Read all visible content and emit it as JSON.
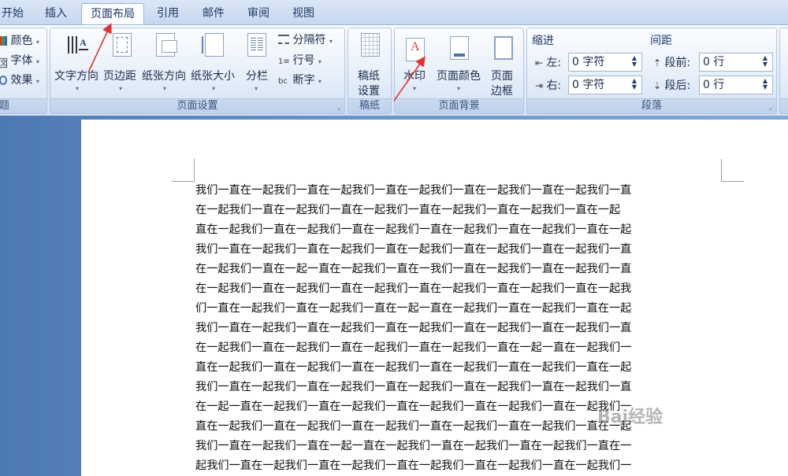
{
  "tabs": [
    "开始",
    "插入",
    "页面布局",
    "引用",
    "邮件",
    "审阅",
    "视图"
  ],
  "theme_group": {
    "label": "题",
    "colors": "颜色",
    "fonts": "字体",
    "effects": "效果"
  },
  "page_setup": {
    "label": "页面设置",
    "text_direction": "文字方向",
    "margins": "页边距",
    "orientation": "纸张方向",
    "size": "纸张大小",
    "columns": "分栏",
    "breaks": "分隔符",
    "line_numbers": "行号",
    "hyphenation": "断字"
  },
  "draft_paper": {
    "label": "稿纸",
    "button_line1": "稿纸",
    "button_line2": "设置"
  },
  "page_background": {
    "label": "页面背景",
    "watermark": "水印",
    "page_color": "页面颜色",
    "border_line1": "页面",
    "border_line2": "边框"
  },
  "paragraph": {
    "label": "段落",
    "indent_title": "缩进",
    "left_label": "左:",
    "left_value": "0 字符",
    "right_label": "右:",
    "right_value": "0 字符",
    "spacing_title": "间距",
    "before_label": "段前:",
    "before_value": "0 行",
    "after_label": "段后:",
    "after_value": "0 行"
  },
  "document_lines": [
    "我们一直在一起我们一直在一起我们一直在一起我们一直在一起我们一直在一起我们一直",
    "在一起我们一直在一起我们一直在一起我们一直在一起我们一直在一起我们一直在一起",
    "直在一起我们一直在一起我们一直在一起我们一直在一起我们一直在一起我们一直在一起",
    "我们一直在一起我们一直在一起我们一直在一起我们一直在一起我们一直在一起我们一直",
    "在一起我们一直在一起一直在一起我们一直在一我们一直在一起我们一直在一起我们一直",
    "在一起我们一直在一起我们一直在一起我们一直在一起我们一直在一起我们一直在一起我",
    "们一直在一起我们一直在一起我们一直在一起一直在一起我们一直在一起我们一直在一起",
    "我们一直在一起我们一直在一起我们一直在一起我们一直在一起我们一直在一起我们一直",
    "在一起我们一直在一起我们一直在一起我们一直在一起我们一直在一起一直在一起我们一",
    "直在一起我们一直在一起我们一直在一起我们一直在一起我们一直在一起我们一直在一起",
    "我们一直在一起我们一直在一起我们一直在一起我们一直在一起我们一直在一起我们一直",
    "在一起一直在一起我们一直在一起我们一直在一起我们一直在一起我们一直在一起我们一",
    "直在一起我们一直在一起我们一直在一起我们一直在一起我们一直在一起我们一直在一起",
    "我们一直在一起我们一直在一起一直在一起我们一直在一起我们一直在一起我们一直在一",
    "起我们一直在一起我们一直在一起我们一直在一起我们一直在一起我们一直在一起我们一"
  ],
  "watermark_text": "Bai经验",
  "colors": {
    "accent": "#1e3963",
    "arrow": "#e53030",
    "doc_background": "#5b86bf"
  }
}
